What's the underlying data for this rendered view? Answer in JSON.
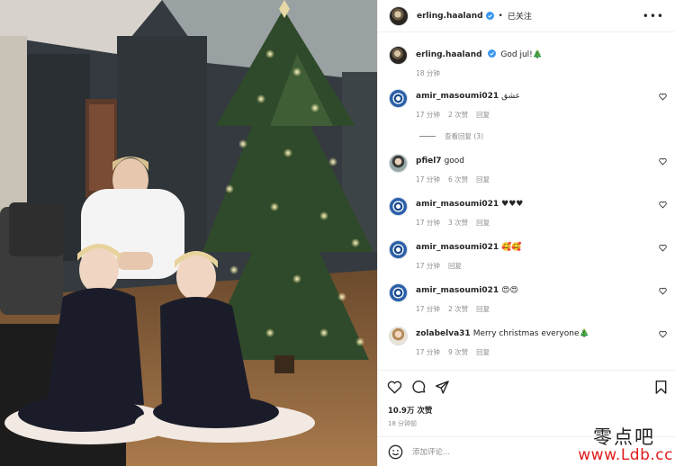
{
  "header": {
    "username": "erling.haaland",
    "dot": "•",
    "follow_label": "已关注",
    "more_icon": "more-horizontal-icon"
  },
  "post": {
    "username": "erling.haaland",
    "caption": "God jul!🎄",
    "time": "18 分钟"
  },
  "comments": [
    {
      "username": "amir_masoumi021",
      "text": "عشق",
      "time": "17 分钟",
      "likes": "2 次赞",
      "reply": "回复",
      "avatar": "blue-badge"
    },
    {
      "username": "pfiel7",
      "text": "good",
      "time": "17 分钟",
      "likes": "6 次赞",
      "reply": "回复",
      "avatar": "person"
    },
    {
      "username": "amir_masoumi021",
      "text": "♥♥♥",
      "time": "17 分钟",
      "likes": "3 次赞",
      "reply": "回复",
      "avatar": "blue-badge"
    },
    {
      "username": "amir_masoumi021",
      "text": "🥰🥰",
      "time": "17 分钟",
      "likes": "",
      "reply": "回复",
      "avatar": "blue-badge"
    },
    {
      "username": "amir_masoumi021",
      "text": "😍😍",
      "time": "17 分钟",
      "likes": "2 次赞",
      "reply": "回复",
      "avatar": "blue-badge"
    },
    {
      "username": "zolabelva31",
      "text": "Merry christmas everyone🎄",
      "time": "17 分钟",
      "likes": "9 次赞",
      "reply": "回复",
      "avatar": "person"
    }
  ],
  "view_replies": "查看回复 (3)",
  "actions": {
    "like_icon": "heart-icon",
    "comment_icon": "comment-icon",
    "share_icon": "send-icon",
    "save_icon": "bookmark-icon"
  },
  "likes_count": "10.9万 次赞",
  "post_age": "18 分钟前",
  "add_comment": {
    "placeholder": "添加评论...",
    "emoji_icon": "smiley-icon"
  },
  "watermark": {
    "chinese": "零点吧",
    "url": "www.Ldb.cc"
  },
  "colors": {
    "verified": "#3897f0",
    "secondary_text": "#8e8e8e",
    "watermark_url": "#e01b1b"
  }
}
